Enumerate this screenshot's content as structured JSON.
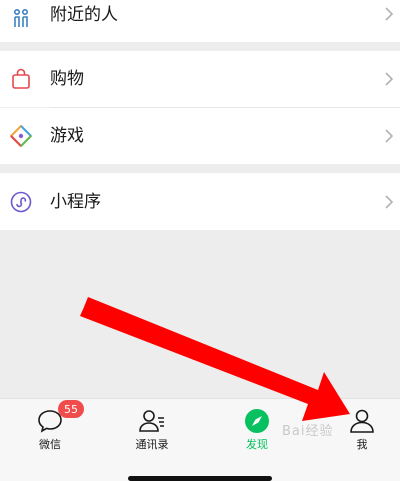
{
  "menu": {
    "nearby": {
      "label": "附近的人",
      "icon": "people-nearby-icon"
    },
    "shopping": {
      "label": "购物",
      "icon": "shopping-bag-icon"
    },
    "games": {
      "label": "游戏",
      "icon": "game-diamond-icon"
    },
    "miniprogram": {
      "label": "小程序",
      "icon": "mini-program-icon"
    }
  },
  "tabbar": {
    "tabs": [
      {
        "label": "微信",
        "icon": "chat-bubble-icon",
        "badge": "55",
        "active": false
      },
      {
        "label": "通讯录",
        "icon": "contacts-icon",
        "active": false
      },
      {
        "label": "发现",
        "icon": "compass-icon",
        "active": true
      },
      {
        "label": "我",
        "icon": "person-icon",
        "active": false
      }
    ]
  },
  "watermark": "Bai经验",
  "colors": {
    "accent": "#07c160",
    "badge": "#f04c4c",
    "arrow": "#ff0000",
    "background": "#ededed"
  }
}
